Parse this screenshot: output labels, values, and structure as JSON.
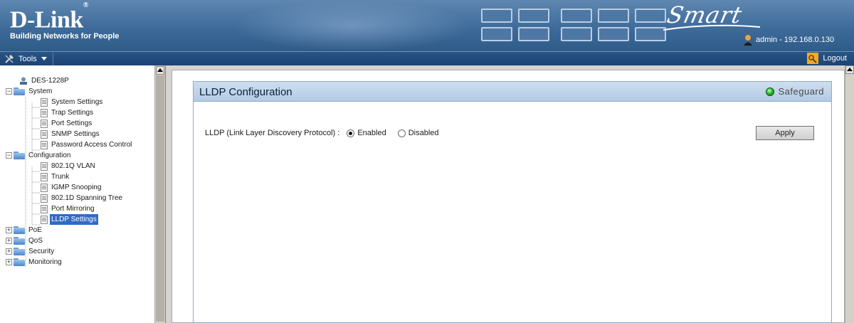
{
  "header": {
    "logo_name": "D-Link",
    "logo_reg": "®",
    "tagline": "Building Networks for People",
    "product_mark": "Smart",
    "user_info": "admin - 192.168.0.130"
  },
  "toolbar": {
    "tools_label": "Tools",
    "logout_label": "Logout"
  },
  "tree": {
    "root": "DES-1228P",
    "items": [
      {
        "label": "System",
        "type": "folder",
        "expanded": true
      },
      {
        "label": "System Settings",
        "type": "page"
      },
      {
        "label": "Trap Settings",
        "type": "page"
      },
      {
        "label": "Port Settings",
        "type": "page"
      },
      {
        "label": "SNMP Settings",
        "type": "page"
      },
      {
        "label": "Password Access Control",
        "type": "page"
      },
      {
        "label": "Configuration",
        "type": "folder",
        "expanded": true
      },
      {
        "label": "802.1Q VLAN",
        "type": "page"
      },
      {
        "label": "Trunk",
        "type": "page"
      },
      {
        "label": "IGMP Snooping",
        "type": "page"
      },
      {
        "label": "802.1D Spanning Tree",
        "type": "page"
      },
      {
        "label": "Port Mirroring",
        "type": "page"
      },
      {
        "label": "LLDP Settings",
        "type": "page",
        "selected": true
      },
      {
        "label": "PoE",
        "type": "folder",
        "expanded": false
      },
      {
        "label": "QoS",
        "type": "folder",
        "expanded": false
      },
      {
        "label": "Security",
        "type": "folder",
        "expanded": false
      },
      {
        "label": "Monitoring",
        "type": "folder",
        "expanded": false
      }
    ]
  },
  "panel": {
    "title": "LLDP Configuration",
    "safeguard_label": "Safeguard",
    "field_label": "LLDP (Link Layer Discovery Protocol) :",
    "option_enabled": "Enabled",
    "option_disabled": "Disabled",
    "selected_option": "Enabled",
    "apply_label": "Apply"
  },
  "colors": {
    "banner": "#3e6b9a",
    "toolbar": "#1c4474",
    "selection": "#316ac5",
    "safeguard_led": "#2dbb2d"
  }
}
